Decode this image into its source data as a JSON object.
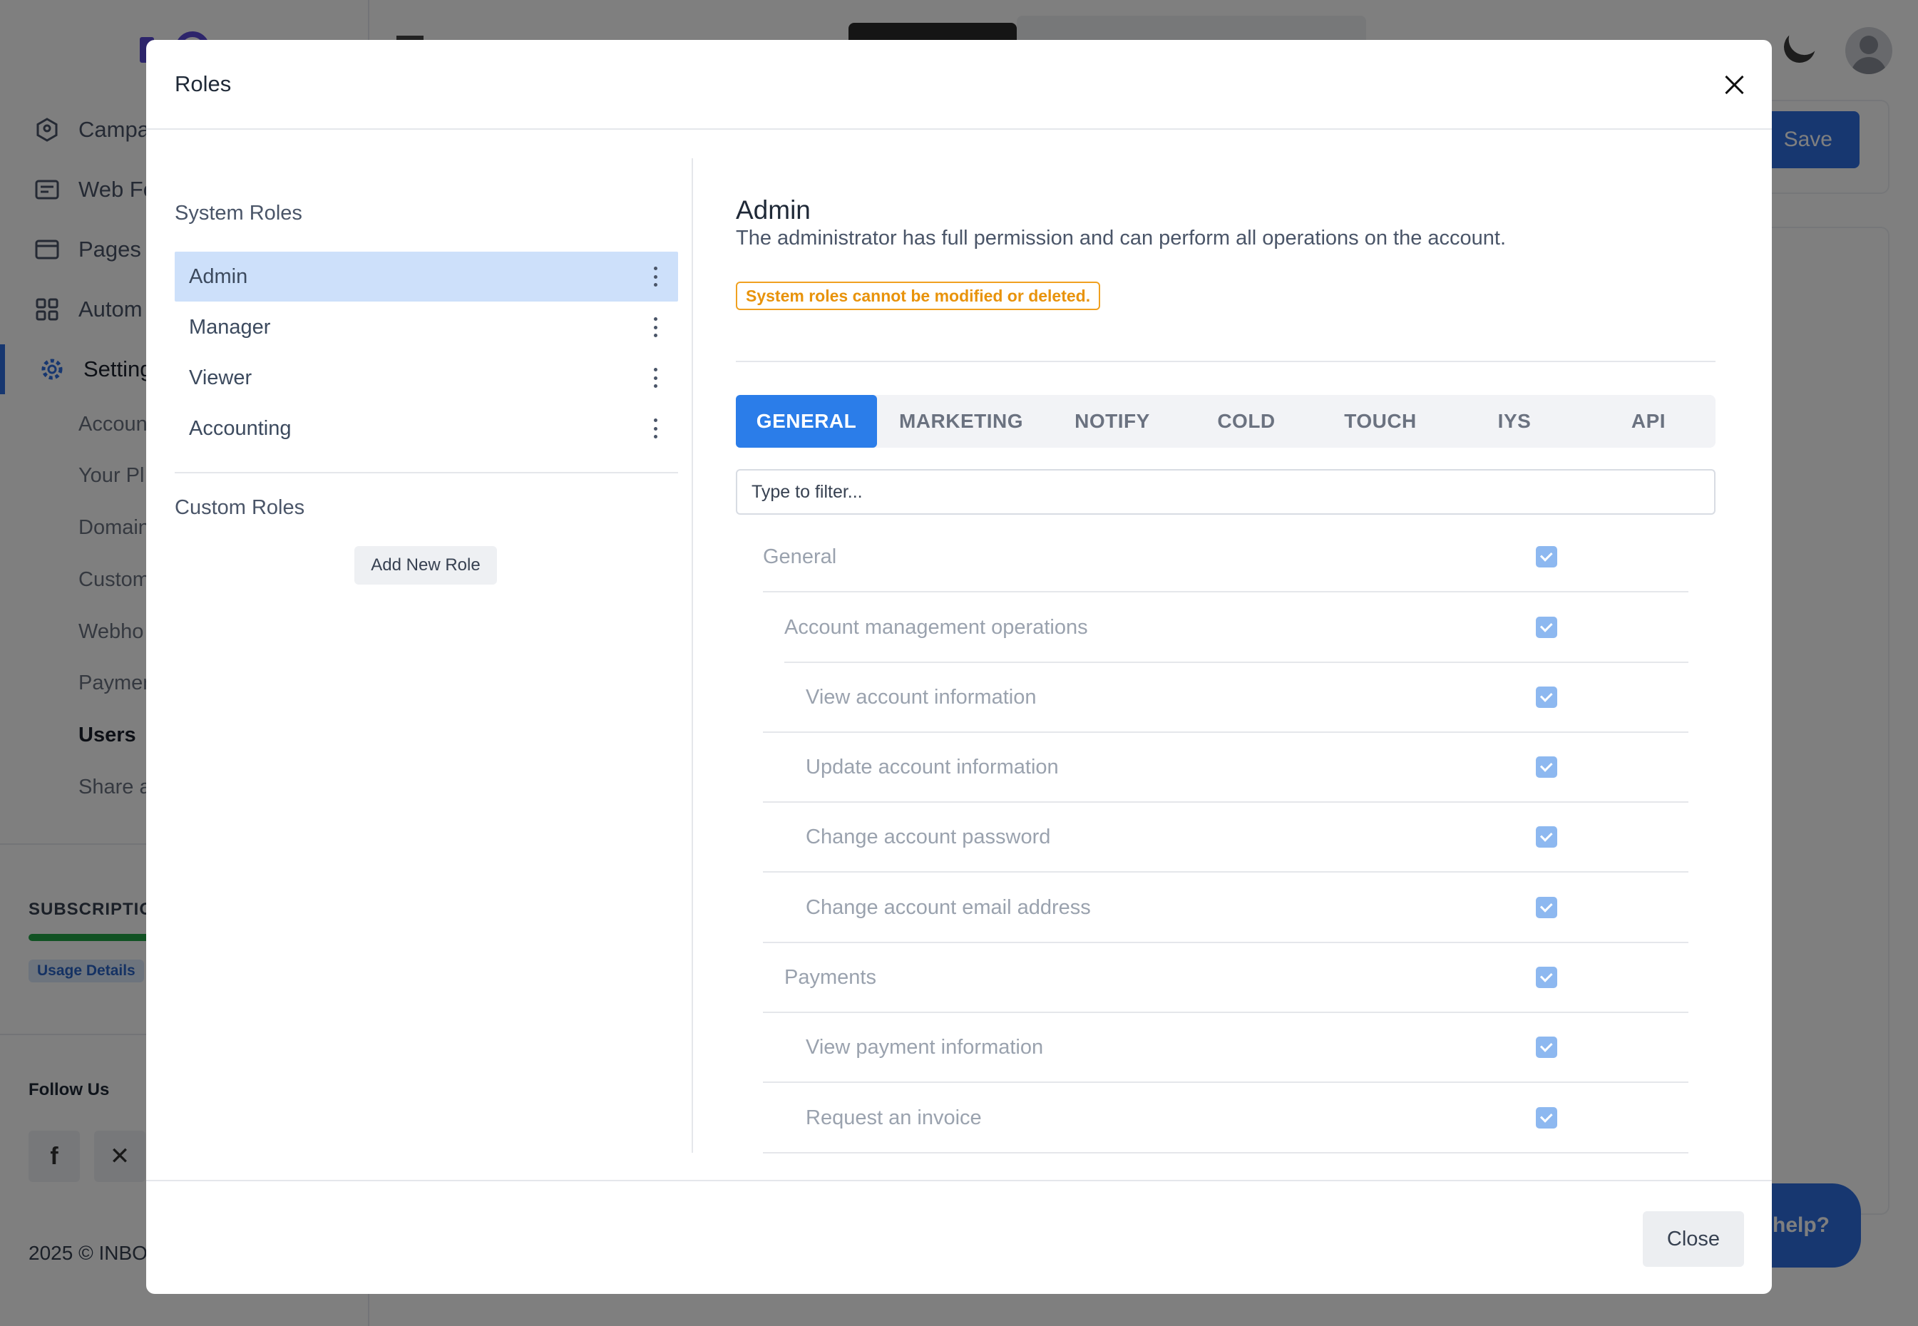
{
  "sidebar": {
    "nav": [
      {
        "label": "Campa",
        "icon": "badge-icon"
      },
      {
        "label": "Web Fo",
        "icon": "form-icon"
      },
      {
        "label": "Pages",
        "icon": "browser-icon"
      },
      {
        "label": "Autom",
        "icon": "grid-icon"
      },
      {
        "label": "Setting",
        "icon": "gear-icon"
      }
    ],
    "sub_items": [
      "Accoun",
      "Your Pl",
      "Domain",
      "Custom",
      "Webho",
      "Paymen",
      "Users",
      "Share a"
    ],
    "subscription_title": "SUBSCRIPTIO",
    "usage_label": "Usage Details",
    "follow_label": "Follow Us",
    "social": [
      "f",
      "✕"
    ],
    "copyright": "2025 © INBO"
  },
  "topbar": {
    "save_label": "Save",
    "help_label": "help?"
  },
  "modal": {
    "title": "Roles",
    "system_roles_title": "System Roles",
    "system_roles": [
      "Admin",
      "Manager",
      "Viewer",
      "Accounting"
    ],
    "selected_role": "Admin",
    "custom_roles_title": "Custom Roles",
    "add_role_label": "Add New Role",
    "role_detail": {
      "name": "Admin",
      "description": "The administrator has full permission and can perform all operations on the account.",
      "warning": "System roles cannot be modified or deleted."
    },
    "tabs": [
      "GENERAL",
      "MARKETING",
      "NOTIFY",
      "COLD",
      "TOUCH",
      "IYS",
      "API"
    ],
    "active_tab": "GENERAL",
    "filter_placeholder": "Type to filter...",
    "permissions": [
      {
        "label": "General",
        "level": 0,
        "checked": true
      },
      {
        "label": "Account management operations",
        "level": 1,
        "checked": true
      },
      {
        "label": "View account information",
        "level": 2,
        "checked": true
      },
      {
        "label": "Update account information",
        "level": 2,
        "checked": true
      },
      {
        "label": "Change account password",
        "level": 2,
        "checked": true
      },
      {
        "label": "Change account email address",
        "level": 2,
        "checked": true
      },
      {
        "label": "Payments",
        "level": 1,
        "checked": true
      },
      {
        "label": "View payment information",
        "level": 2,
        "checked": true
      },
      {
        "label": "Request an invoice",
        "level": 2,
        "checked": true
      }
    ],
    "close_label": "Close"
  },
  "colors": {
    "accent": "#2b7de9",
    "selected_row": "#cde0fa",
    "warning": "#e8930b",
    "checkbox": "#8db8f0"
  }
}
